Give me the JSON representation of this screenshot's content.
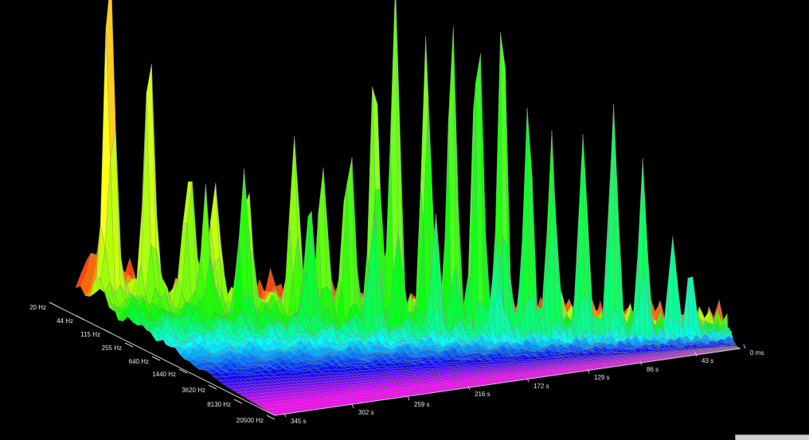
{
  "chart_data": {
    "type": "surface",
    "title": "",
    "xlabel": "",
    "ylabel": "",
    "frequency_axis": {
      "ticks": [
        "20 Hz",
        "44 Hz",
        "115 Hz",
        "255 Hz",
        "640 Hz",
        "1440 Hz",
        "3620 Hz",
        "8130 Hz",
        "20500 Hz"
      ]
    },
    "time_axis": {
      "ticks": [
        "0 ms",
        "43 s",
        "86 s",
        "129 s",
        "172 s",
        "216 s",
        "259 s",
        "302 s",
        "345 s"
      ]
    },
    "z_range": [
      0,
      1
    ],
    "colormap": [
      "#ff0000",
      "#ff8a00",
      "#ffff00",
      "#00ff00",
      "#00ffff",
      "#0000ff",
      "#ff00ff"
    ],
    "grid_color": "#8c8c8c",
    "peaks": [
      {
        "freq": 0.02,
        "time": 0.98,
        "value": 0.12
      },
      {
        "freq": 0.14,
        "time": 0.97,
        "value": 0.92
      },
      {
        "freq": 0.21,
        "time": 0.92,
        "value": 0.7
      },
      {
        "freq": 0.24,
        "time": 0.86,
        "value": 0.4
      },
      {
        "freq": 0.18,
        "time": 0.81,
        "value": 0.3
      },
      {
        "freq": 0.27,
        "time": 0.77,
        "value": 0.35
      },
      {
        "freq": 0.31,
        "time": 0.7,
        "value": 0.45
      },
      {
        "freq": 0.34,
        "time": 0.66,
        "value": 0.38
      },
      {
        "freq": 0.37,
        "time": 0.62,
        "value": 0.55
      },
      {
        "freq": 0.4,
        "time": 0.58,
        "value": 0.72
      },
      {
        "freq": 0.43,
        "time": 0.55,
        "value": 0.88
      },
      {
        "freq": 0.45,
        "time": 0.5,
        "value": 0.86
      },
      {
        "freq": 0.47,
        "time": 0.46,
        "value": 0.8
      },
      {
        "freq": 0.5,
        "time": 0.42,
        "value": 0.98
      },
      {
        "freq": 0.52,
        "time": 0.38,
        "value": 0.84
      },
      {
        "freq": 0.55,
        "time": 0.34,
        "value": 0.65
      },
      {
        "freq": 0.58,
        "time": 0.3,
        "value": 0.6
      },
      {
        "freq": 0.6,
        "time": 0.25,
        "value": 0.52
      },
      {
        "freq": 0.63,
        "time": 0.2,
        "value": 0.72
      },
      {
        "freq": 0.65,
        "time": 0.15,
        "value": 0.42
      },
      {
        "freq": 0.68,
        "time": 0.1,
        "value": 0.28
      },
      {
        "freq": 0.72,
        "time": 0.07,
        "value": 0.2
      },
      {
        "freq": 0.5,
        "time": 0.7,
        "value": 0.35
      },
      {
        "freq": 0.55,
        "time": 0.6,
        "value": 0.32
      },
      {
        "freq": 0.42,
        "time": 0.8,
        "value": 0.4
      },
      {
        "freq": 0.6,
        "time": 0.5,
        "value": 0.3
      },
      {
        "freq": 0.35,
        "time": 0.85,
        "value": 0.3
      },
      {
        "freq": 0.66,
        "time": 0.4,
        "value": 0.25
      }
    ]
  }
}
